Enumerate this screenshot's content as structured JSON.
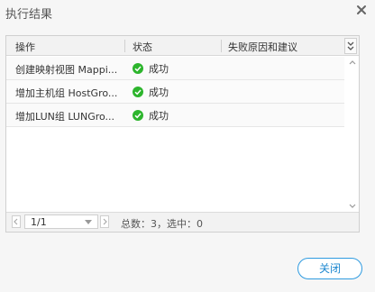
{
  "dialog": {
    "title": "执行结果",
    "close_icon": "close-icon"
  },
  "table": {
    "columns": [
      "操作",
      "状态",
      "失败原因和建议"
    ],
    "rows": [
      {
        "operation": "创建映射视图 Mappi...",
        "status": "成功",
        "status_icon": "check-circle-icon"
      },
      {
        "operation": "增加主机组 HostGro...",
        "status": "成功",
        "status_icon": "check-circle-icon"
      },
      {
        "operation": "增加LUN组 LUNGro...",
        "status": "成功",
        "status_icon": "check-circle-icon"
      }
    ],
    "status_color": "#2db52d"
  },
  "pager": {
    "page": "1/1",
    "summary": "总数：3，选中：0"
  },
  "footer": {
    "close_label": "关闭"
  },
  "colors": {
    "accent": "#2f9be0",
    "background": "#f6f6f6"
  }
}
